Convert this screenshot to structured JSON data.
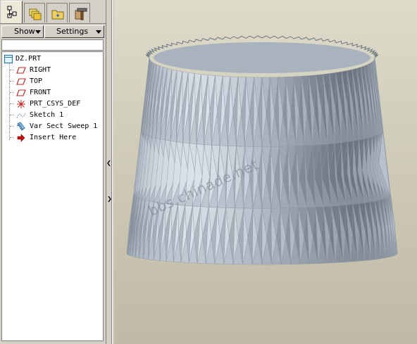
{
  "tabs": [
    {
      "icon": "model-tree-icon",
      "active": true
    },
    {
      "icon": "layers-icon",
      "active": false
    },
    {
      "icon": "folder-browser-icon",
      "active": false
    },
    {
      "icon": "favorites-tools-icon",
      "active": false
    }
  ],
  "toolbar": {
    "show_label": "Show",
    "settings_label": "Settings"
  },
  "tree": {
    "items": [
      {
        "label": "DZ.PRT",
        "icon": "part-icon"
      },
      {
        "label": "RIGHT",
        "icon": "datum-plane-icon"
      },
      {
        "label": "TOP",
        "icon": "datum-plane-icon"
      },
      {
        "label": "FRONT",
        "icon": "datum-plane-icon"
      },
      {
        "label": "PRT_CSYS_DEF",
        "icon": "coordinate-system-icon"
      },
      {
        "label": "Sketch 1",
        "icon": "sketch-icon"
      },
      {
        "label": "Var Sect Sweep 1",
        "icon": "sweep-feature-icon"
      },
      {
        "label": "Insert Here",
        "icon": "insert-arrow-icon"
      }
    ]
  },
  "splitter": {
    "collapse_icon": "collapse-left-icon",
    "expand_icon": "expand-right-icon"
  },
  "viewport": {
    "watermark": "bbs.chinade.net",
    "colors": {
      "background_top": "#dedbcb",
      "background_bottom": "#bfbaa6",
      "model_light": "#dfe6ee",
      "model_mid": "#a9b3be",
      "model_dark": "#6d7680"
    }
  }
}
